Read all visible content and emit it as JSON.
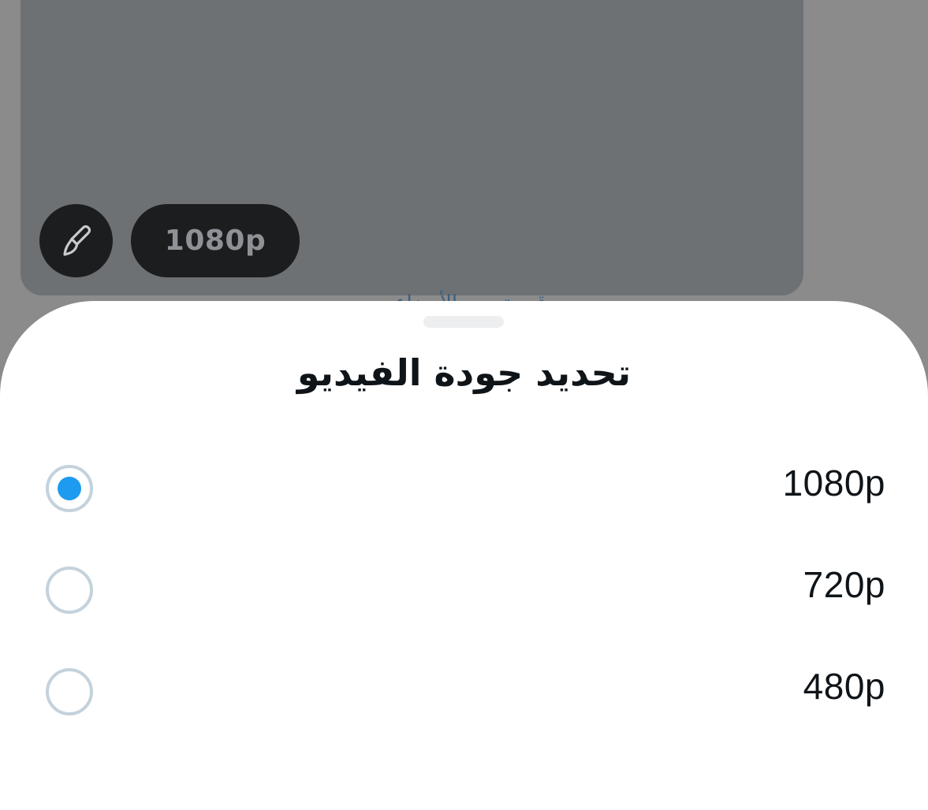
{
  "background": {
    "edit_icon": "brush-icon",
    "quality_pill_label": "1080p",
    "peek_text": "قم بتحديد الأوضاع"
  },
  "sheet": {
    "title": "تحديد جودة الفيديو",
    "options": [
      {
        "label": "1080p",
        "selected": true
      },
      {
        "label": "720p",
        "selected": false
      },
      {
        "label": "480p",
        "selected": false
      }
    ]
  },
  "colors": {
    "accent": "#1d9bf0",
    "radio_border": "#c4d2dc",
    "text": "#0f1419"
  }
}
